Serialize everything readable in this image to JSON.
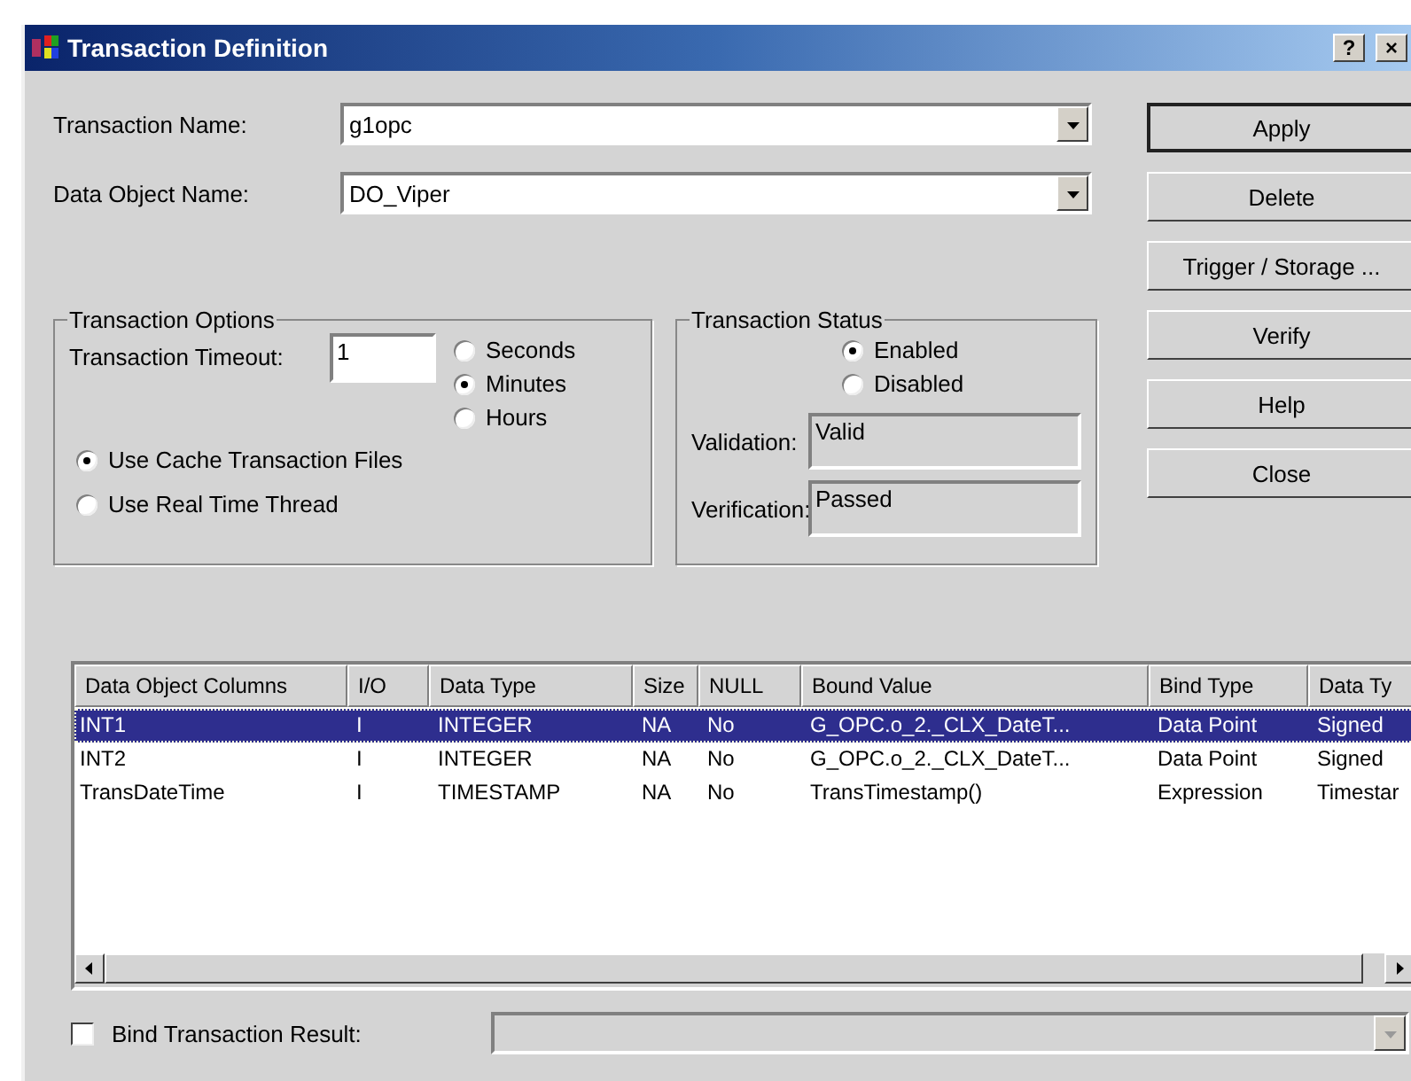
{
  "window": {
    "title": "Transaction Definition",
    "help_button": "?",
    "close_button": "×"
  },
  "fields": [
    {
      "label": "Transaction Name:",
      "value": "g1opc"
    },
    {
      "label": "Data Object Name:",
      "value": "DO_Viper"
    }
  ],
  "buttons": [
    {
      "label": "Apply",
      "default": true
    },
    {
      "label": "Delete",
      "default": false
    },
    {
      "label": "Trigger / Storage ...",
      "default": false
    },
    {
      "label": "Verify",
      "default": false
    },
    {
      "label": "Help",
      "default": false
    },
    {
      "label": "Close",
      "default": false
    }
  ],
  "transaction_options": {
    "title": "Transaction Options",
    "timeout_label": "Transaction Timeout:",
    "timeout_value": "1",
    "units": [
      {
        "label": "Seconds",
        "selected": false
      },
      {
        "label": "Minutes",
        "selected": true
      },
      {
        "label": "Hours",
        "selected": false
      }
    ],
    "modes": [
      {
        "label": "Use Cache Transaction Files",
        "selected": true
      },
      {
        "label": "Use Real Time Thread",
        "selected": false
      }
    ]
  },
  "transaction_status": {
    "title": "Transaction Status",
    "states": [
      {
        "label": "Enabled",
        "selected": true
      },
      {
        "label": "Disabled",
        "selected": false
      }
    ],
    "validation": {
      "label": "Validation:",
      "value": "Valid"
    },
    "verification": {
      "label": "Verification:",
      "value": "Passed"
    }
  },
  "table": {
    "columns": [
      "Data Object Columns",
      "I/O",
      "Data Type",
      "Size",
      "NULL",
      "Bound Value",
      "Bind Type",
      "Data Ty"
    ],
    "rows": [
      {
        "selected": true,
        "cells": [
          "INT1",
          "I",
          "INTEGER",
          "NA",
          "No",
          "G_OPC.o_2._CLX_DateT...",
          "Data Point",
          "Signed"
        ]
      },
      {
        "selected": false,
        "cells": [
          "INT2",
          "I",
          "INTEGER",
          "NA",
          "No",
          "G_OPC.o_2._CLX_DateT...",
          "Data Point",
          "Signed"
        ]
      },
      {
        "selected": false,
        "cells": [
          "TransDateTime",
          "I",
          "TIMESTAMP",
          "NA",
          "No",
          "TransTimestamp()",
          "Expression",
          "Timestar"
        ]
      }
    ]
  },
  "bind_result": {
    "label": "Bind Transaction Result:",
    "checked": false
  }
}
